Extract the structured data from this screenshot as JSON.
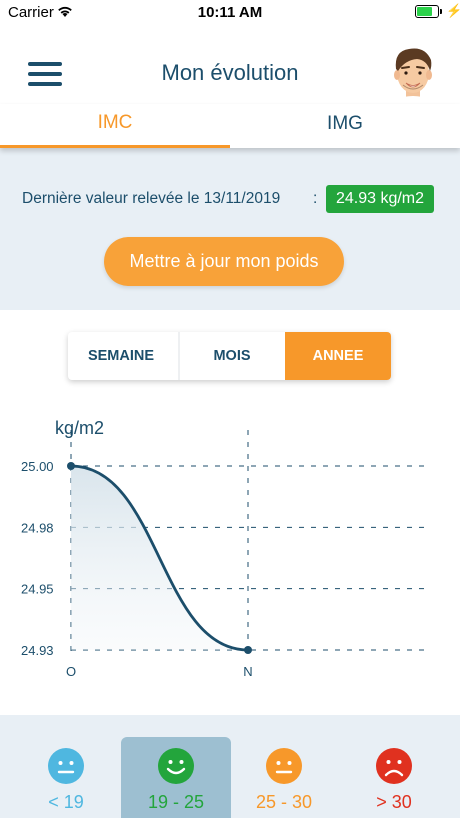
{
  "status_bar": {
    "carrier": "Carrier",
    "time": "10:11 AM",
    "battery_level": 0.75
  },
  "header": {
    "title": "Mon évolution",
    "menu_icon": "hamburger-menu-icon",
    "avatar": "user-avatar"
  },
  "tabs": [
    {
      "label": "IMC",
      "selected": true
    },
    {
      "label": "IMG",
      "selected": false
    }
  ],
  "summary": {
    "last_value_text": "Dernière valeur relevée le 13/11/2019",
    "separator": ":",
    "value": "24.93 kg/m2",
    "update_button": "Mettre à jour mon poids"
  },
  "periods": [
    {
      "label": "SEMAINE",
      "selected": false
    },
    {
      "label": "MOIS",
      "selected": false
    },
    {
      "label": "ANNEE",
      "selected": true
    }
  ],
  "chart_data": {
    "type": "line",
    "ylabel": "kg/m2",
    "y_ticks": [
      "25.00",
      "24.98",
      "24.95",
      "24.93"
    ],
    "x": [
      "O",
      "N"
    ],
    "values": [
      25.0,
      24.93
    ],
    "ylim": [
      24.93,
      25.0
    ],
    "grid": true,
    "line_color": "#1c4e6b"
  },
  "categories": [
    {
      "range": "< 19",
      "color": "#4fb7e0",
      "face": "neutral-face-icon",
      "selected": false
    },
    {
      "range": "19 - 25",
      "color": "#23a53c",
      "face": "smiling-face-icon",
      "selected": true
    },
    {
      "range": "25 - 30",
      "color": "#f7982a",
      "face": "neutral-face-icon",
      "selected": false
    },
    {
      "range": "> 30",
      "color": "#e0311f",
      "face": "frowning-face-icon",
      "selected": false
    }
  ]
}
